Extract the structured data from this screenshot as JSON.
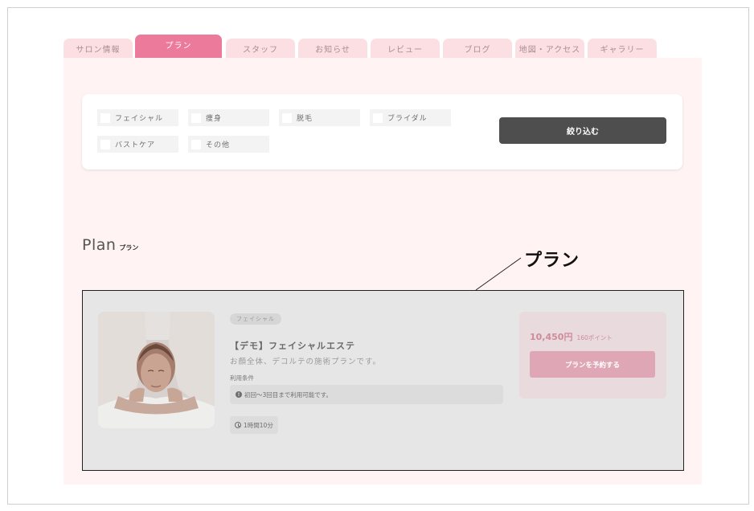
{
  "tabs": [
    {
      "label": "サロン情報",
      "active": false
    },
    {
      "label": "プラン",
      "active": true
    },
    {
      "label": "スタッフ",
      "active": false
    },
    {
      "label": "お知らせ",
      "active": false
    },
    {
      "label": "レビュー",
      "active": false
    },
    {
      "label": "ブログ",
      "active": false
    },
    {
      "label": "地図・アクセス",
      "active": false
    },
    {
      "label": "ギャラリー",
      "active": false
    }
  ],
  "filters": {
    "categories": [
      {
        "label": "フェイシャル",
        "checked": false
      },
      {
        "label": "痩身",
        "checked": false
      },
      {
        "label": "脱毛",
        "checked": false
      },
      {
        "label": "ブライダル",
        "checked": false
      },
      {
        "label": "バストケア",
        "checked": false
      },
      {
        "label": "その他",
        "checked": false
      }
    ],
    "submit_label": "絞り込む"
  },
  "section": {
    "title_en": "Plan",
    "title_jp": "プラン"
  },
  "plan": {
    "tag": "フェイシャル",
    "name": "【デモ】フェイシャルエステ",
    "description": "お顔全体、デコルテの施術プランです。",
    "conditions_label": "利用条件",
    "condition": "初回～3回目まで利用可能です。",
    "duration": "1時間10分",
    "price": "10,450円",
    "points": "160ポイント",
    "book_label": "プランを予約する"
  },
  "annotation": {
    "label": "プラン"
  },
  "colors": {
    "tab_active": "#ec7a9b",
    "tab_inactive": "#fcdfe3",
    "content_bg": "#fff3f3",
    "filter_button": "#4e4e4e",
    "price_text": "#cf8b9a",
    "book_button": "#dfa6b6"
  }
}
